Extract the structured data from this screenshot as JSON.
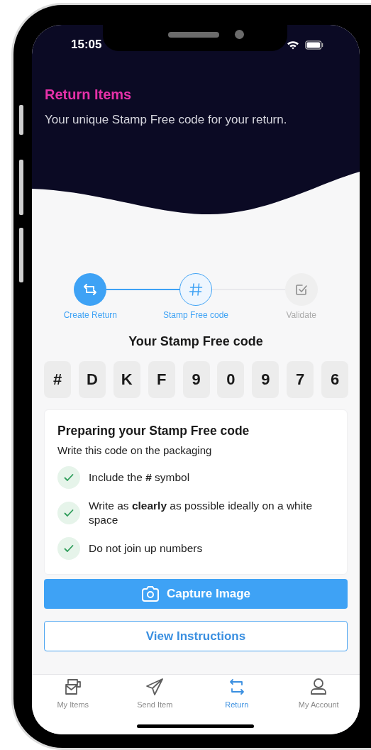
{
  "status_bar": {
    "time": "15:05"
  },
  "header": {
    "title": "Return Items",
    "subtitle": "Your unique Stamp Free code for your return."
  },
  "steps": [
    {
      "label": "Create Return",
      "kind": "return",
      "completed": true,
      "selected": false
    },
    {
      "label": "Stamp Free code",
      "kind": "code",
      "completed": false,
      "selected": true
    },
    {
      "label": "Validate",
      "kind": "validate",
      "completed": false,
      "selected": false
    }
  ],
  "code": {
    "heading": "Your Stamp Free code",
    "characters": [
      "#",
      "D",
      "K",
      "F",
      "9",
      "0",
      "9",
      "7",
      "6"
    ]
  },
  "instructions": {
    "title": "Preparing your Stamp Free code",
    "subtitle": "Write this code on the packaging",
    "items": [
      {
        "text": "Include the **#** symbol",
        "checked": true
      },
      {
        "text": "Write as **clearly** as possible ideally on a white space",
        "checked": true
      },
      {
        "text": "Do not join up numbers",
        "checked": true
      }
    ]
  },
  "buttons": [
    {
      "label": "Capture Image",
      "kind": "primary"
    },
    {
      "label": "View Instructions",
      "kind": "secondary"
    }
  ],
  "tab_bar": [
    {
      "label": "My Items",
      "kind": "items",
      "selected": false
    },
    {
      "label": "Send Item",
      "kind": "send",
      "selected": false
    },
    {
      "label": "Return",
      "kind": "return",
      "selected": true
    },
    {
      "label": "My Account",
      "kind": "account",
      "selected": false
    }
  ]
}
